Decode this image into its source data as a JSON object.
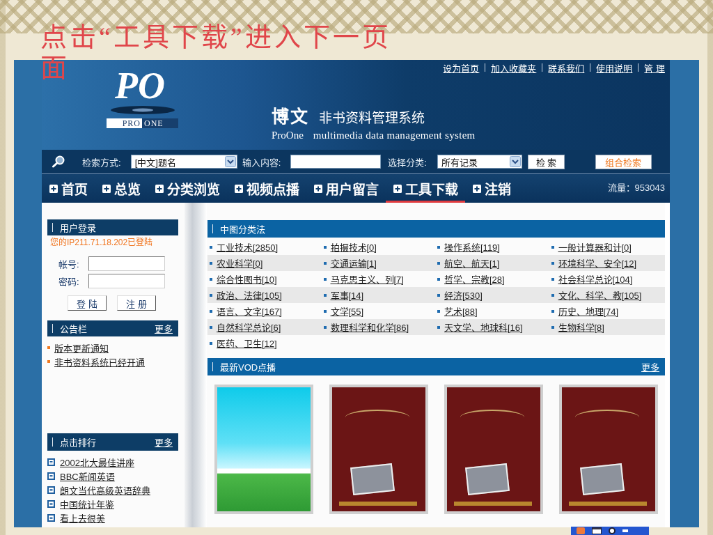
{
  "slide": {
    "title": "点击“工具下载”进入下一页面"
  },
  "header": {
    "top_links": [
      "设为首页",
      "加入收藏夹",
      "联系我们",
      "使用说明",
      "管 理"
    ],
    "logo": {
      "mark": "PO",
      "badge": [
        "PRO",
        "ONE"
      ]
    },
    "brand": "博文",
    "system_name": "非书资料管理系统",
    "subtitle_brand": "ProOne",
    "subtitle": "multimedia data management system"
  },
  "search": {
    "mode_label": "检索方式:",
    "mode_value": "[中文]题名",
    "input_label": "输入内容:",
    "category_label": "选择分类:",
    "category_value": "所有记录",
    "buttons": [
      {
        "label": "检 索",
        "kind": "plain"
      },
      {
        "label": "组合检索",
        "kind": "highlight"
      }
    ]
  },
  "nav": {
    "items": [
      {
        "label": "首页",
        "selected": false
      },
      {
        "label": "总览",
        "selected": false
      },
      {
        "label": "分类浏览",
        "selected": false
      },
      {
        "label": "视频点播",
        "selected": false
      },
      {
        "label": "用户留言",
        "selected": false
      },
      {
        "label": "工具下载",
        "selected": true
      },
      {
        "label": "注销",
        "selected": false
      }
    ],
    "traffic": "流量：953043"
  },
  "sidebar": {
    "login": {
      "title": "用户登录",
      "message": "您的IP211.71.18.202已登陆",
      "fields": [
        {
          "label": "帐号:"
        },
        {
          "label": "密码:"
        }
      ],
      "buttons": [
        "登 陆",
        "注 册"
      ]
    },
    "notices": {
      "title": "公告栏",
      "more": "更多",
      "items": [
        "版本更新通知",
        "非书资料系统已经开通"
      ]
    },
    "ranking": {
      "title": "点击排行",
      "more": "更多",
      "items": [
        "2002北大最佳讲座",
        "BBC新闻英语",
        "朗文当代高级英语辞典",
        "中国统计年鉴",
        "看上去很美"
      ]
    }
  },
  "categories": {
    "title": "中图分类法",
    "items": [
      "工业技术[2850]",
      "拍摄技术[0]",
      "操作系统[119]",
      "一般计算器和计[0]",
      "农业科学[0]",
      "交通运输[1]",
      "航空、航天[1]",
      "环境科学、安全[12]",
      "综合性图书[10]",
      "马克思主义、列[7]",
      "哲学、宗教[28]",
      "社会科学总论[104]",
      "政治、法律[105]",
      "军事[14]",
      "经济[530]",
      "文化、科学、教[105]",
      "语言、文字[167]",
      "文学[55]",
      "艺术[88]",
      "历史、地理[74]",
      "自然科学总论[6]",
      "数理科学和化学[86]",
      "天文学、地球科[16]",
      "生物科学[8]",
      "医药、卫生[12]"
    ]
  },
  "vod": {
    "title": "最新VOD点播",
    "more": "更多",
    "covers": [
      {
        "kind": "no-photo"
      },
      {
        "kind": "dvd"
      },
      {
        "kind": "dvd"
      },
      {
        "kind": "dvd"
      }
    ]
  }
}
